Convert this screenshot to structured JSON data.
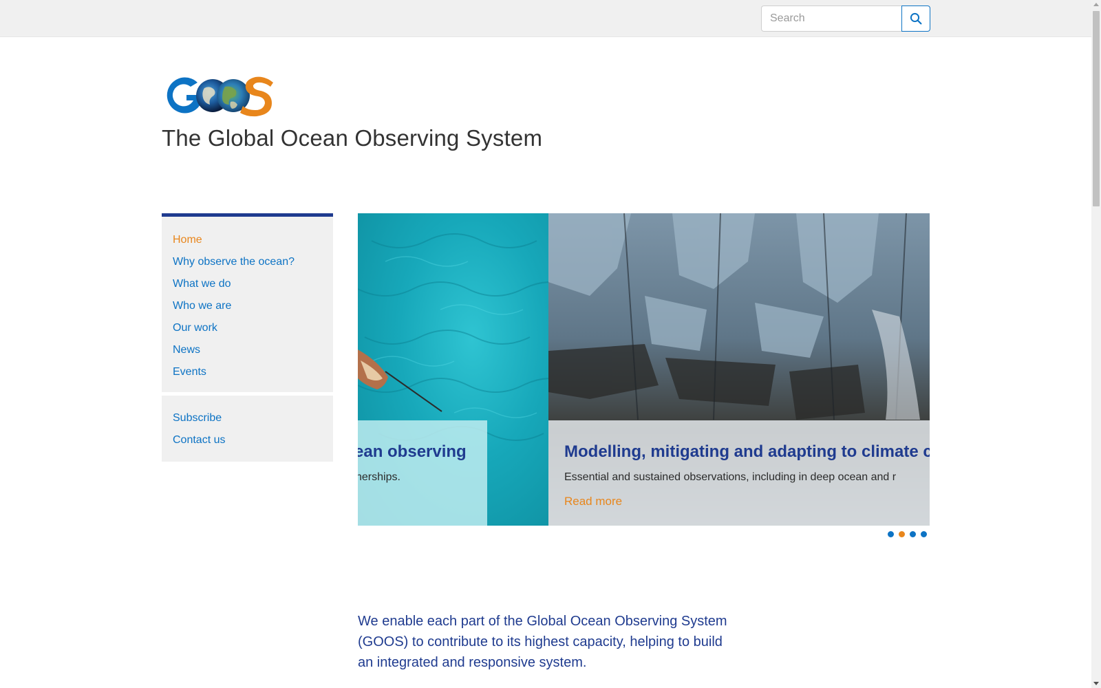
{
  "search": {
    "placeholder": "Search"
  },
  "site": {
    "title": "The Global Ocean Observing System"
  },
  "nav": {
    "items": [
      {
        "label": "Home",
        "active": true
      },
      {
        "label": "Why observe the ocean?"
      },
      {
        "label": "What we do"
      },
      {
        "label": "Who we are"
      },
      {
        "label": "Our work"
      },
      {
        "label": "News"
      },
      {
        "label": "Events"
      }
    ],
    "secondary": [
      {
        "label": "Subscribe"
      },
      {
        "label": "Contact us"
      }
    ]
  },
  "slider": {
    "slides": [
      {
        "title": "ean observing",
        "text": "nerships."
      },
      {
        "title": "Modelling, mitigating and adapting to climate c",
        "text": "Essential and sustained observations, including in deep ocean and r",
        "link": "Read more"
      }
    ],
    "dots": 4,
    "active_dot": 2
  },
  "intro": {
    "text": "We enable each part of the Global Ocean Observing System (GOOS) to contribute to its highest capacity, helping to build an integrated and responsive system."
  },
  "colors": {
    "brand_blue": "#1f3b8f",
    "link_blue": "#0d73c4",
    "accent_orange": "#e8861c",
    "panel_gray": "#f0f0f0"
  },
  "icons": {
    "search": "magnifier-icon",
    "logo": "goos-logo"
  }
}
